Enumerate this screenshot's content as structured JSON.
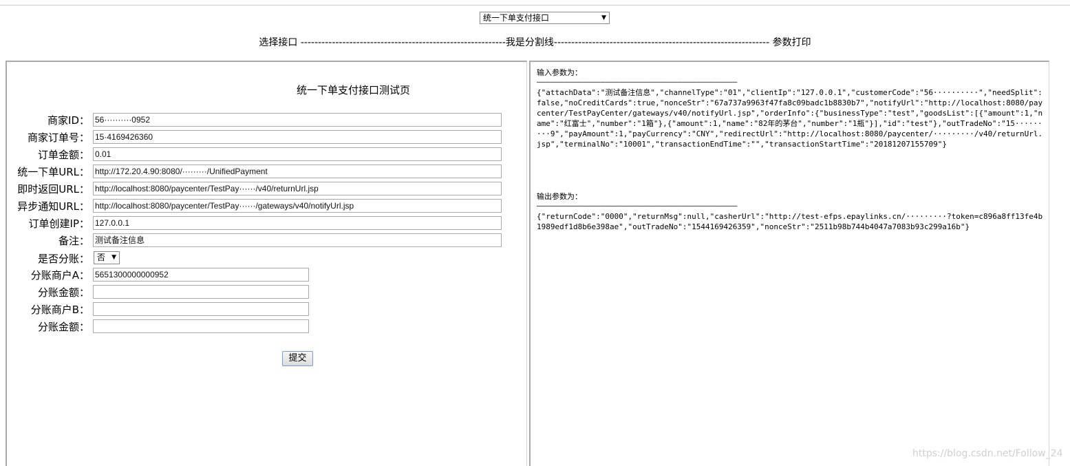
{
  "header": {
    "interface_select": {
      "value": "统一下单支付接口",
      "arrow": "▼"
    },
    "divider_text": "选择接口 -----------------------------------------------------------我是分割线-------------------------------------------------------------- 参数打印"
  },
  "form": {
    "title": "统一下单支付接口测试页",
    "fields": [
      {
        "label": "商家ID：",
        "value": "56··········0952"
      },
      {
        "label": "商家订单号：",
        "value": "15·4169426360"
      },
      {
        "label": "订单金额：",
        "value": "0.01"
      },
      {
        "label": "统一下单URL：",
        "value": "http://172.20.4.90:8080/·········/UnifiedPayment"
      },
      {
        "label": "即时返回URL：",
        "value": "http://localhost:8080/paycenter/TestPay······/v40/returnUrl.jsp"
      },
      {
        "label": "异步通知URL：",
        "value": "http://localhost:8080/paycenter/TestPay······/gateways/v40/notifyUrl.jsp"
      },
      {
        "label": "订单创建IP：",
        "value": "127.0.0.1"
      },
      {
        "label": "备注：",
        "value": "测试备注信息"
      }
    ],
    "split": {
      "label": "是否分账：",
      "value": "否",
      "arrow": "▼"
    },
    "split_fields": [
      {
        "label": "分账商户A：",
        "value": "5651300000000952"
      },
      {
        "label": "分账金额：",
        "value": ""
      },
      {
        "label": "分账商户B：",
        "value": ""
      },
      {
        "label": "分账金额：",
        "value": ""
      }
    ],
    "submit_label": "提交"
  },
  "output": {
    "input_heading": "输入参数为：",
    "rule": "————————————————————————————————————————————",
    "input_json": "{\"attachData\":\"测试备注信息\",\"channelType\":\"01\",\"clientIp\":\"127.0.0.1\",\"customerCode\":\"56··········\",\"needSplit\":false,\"noCreditCards\":true,\"nonceStr\":\"67a737a9963f47fa8c09badc1b8830b7\",\"notifyUrl\":\"http://localhost:8080/paycenter/TestPayCenter/gateways/v40/notifyUrl.jsp\",\"orderInfo\":{\"businessType\":\"test\",\"goodsList\":[{\"amount\":1,\"name\":\"红富士\",\"number\":\"1箱\"},{\"amount\":1,\"name\":\"82年的茅台\",\"number\":\"1瓶\"}],\"id\":\"test\"},\"outTradeNo\":\"15·········9\",\"payAmount\":1,\"payCurrency\":\"CNY\",\"redirectUrl\":\"http://localhost:8080/paycenter/·········/v40/returnUrl.jsp\",\"terminalNo\":\"10001\",\"transactionEndTime\":\"\",\"transactionStartTime\":\"20181207155709\"}",
    "output_heading": "输出参数为：",
    "output_json": "{\"returnCode\":\"0000\",\"returnMsg\":null,\"casherUrl\":\"http://test-efps.epaylinks.cn/·········?token=c896a8ff13fe4b1989edf1d8b6e398ae\",\"outTradeNo\":\"1544169426359\",\"nonceStr\":\"2511b98b744b4047a7083b93c299a16b\"}"
  },
  "watermark": "https://blog.csdn.net/Follow_24"
}
